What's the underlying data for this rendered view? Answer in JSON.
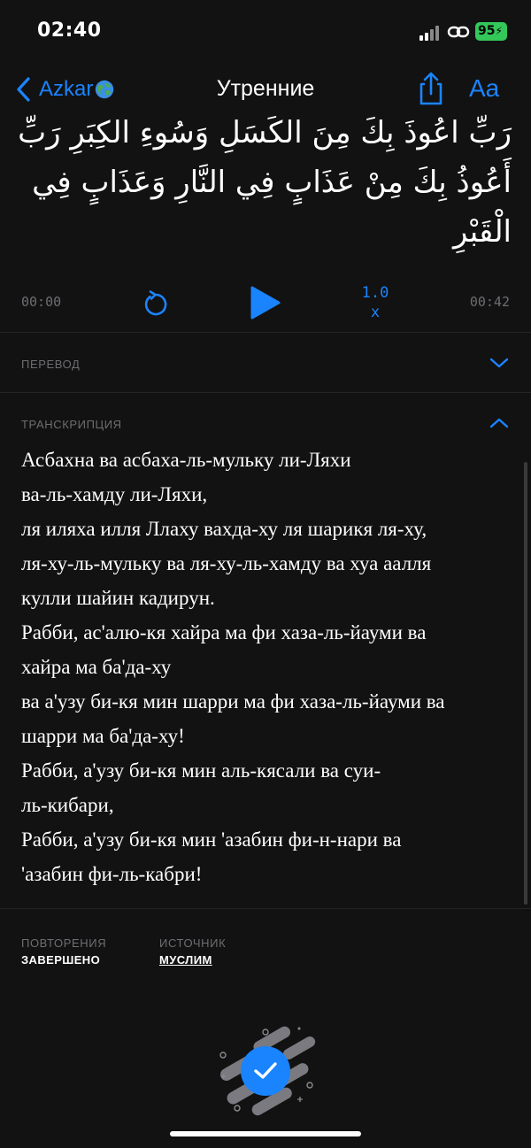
{
  "status_bar": {
    "time": "02:40",
    "battery": "95"
  },
  "nav": {
    "back_label": "Azkar",
    "title": "Утренние",
    "font_button": "Aa"
  },
  "arabic_text": "رَبِّ اعُوذَ بِكَ مِنَ الكَسَلِ وَسُوءِ الكِبَرِ رَبِّ أَعُوذُ بِكَ مِنْ عَذَابٍ فِي النَّارِ وَعَذَابٍ فِي الْقَبْرِ",
  "player": {
    "current_time": "00:00",
    "total_time": "00:42",
    "speed_value": "1.0",
    "speed_unit": "x"
  },
  "translation": {
    "label": "ПЕРЕВОД"
  },
  "transcription": {
    "label": "ТРАНСКРИПЦИЯ",
    "lines": [
      "Асбахна ва асбаха-ль-мульку ли-Ляхи",
      "ва-ль-хамду ли-Ляхи,",
      "ля иляха илля Ллаху вахда-ху ля шарикя ля-ху,",
      "ля-ху-ль-мульку ва ля-ху-ль-хамду ва хуа аалля",
      "кулли шайин кадирун.",
      "Рабби, ас'алю-кя хайра ма фи хаза-ль-йауми ва",
      "хайра ма ба'да-ху",
      "ва а'узу би-кя мин шарри ма фи хаза-ль-йауми ва",
      "шарри ма ба'да-ху!",
      "Рабби, а'узу би-кя мин аль-кясали ва суи-",
      "ль-кибари,",
      "Рабби, а'узу би-кя мин 'азабин фи-н-нари ва",
      "'азабин фи-ль-кабри!"
    ]
  },
  "meta": {
    "repetitions_label": "ПОВТОРЕНИЯ",
    "repetitions_value": "ЗАВЕРШЕНО",
    "source_label": "ИСТОЧНИК",
    "source_value": "МУСЛИМ"
  },
  "colors": {
    "accent": "#1a84ff",
    "background": "#121212",
    "muted": "#6e6e73",
    "battery": "#34c759"
  }
}
